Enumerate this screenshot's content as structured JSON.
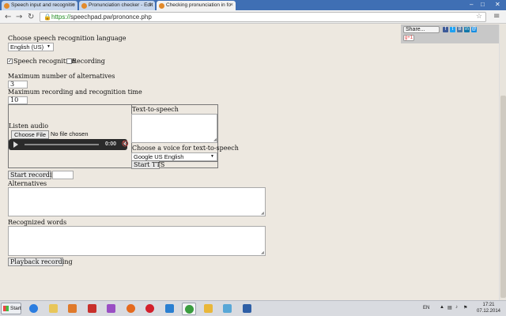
{
  "browser": {
    "tabs": [
      {
        "title": "Speech input and recognitio",
        "active": false
      },
      {
        "title": "Pronunciation checker - Edit",
        "active": false
      },
      {
        "title": "Checking pronunciation in fo",
        "active": true
      }
    ],
    "url_https": "https://",
    "url_rest": "speechpad.pw/prononce.php",
    "window_controls": [
      "–",
      "□",
      "✕"
    ]
  },
  "share": {
    "label": "Share...",
    "icons": [
      {
        "name": "facebook",
        "glyph": "f",
        "color": "#3b5998"
      },
      {
        "name": "twitter",
        "glyph": "t",
        "color": "#1da1f2"
      },
      {
        "name": "vk",
        "glyph": "B",
        "color": "#4c75a3"
      },
      {
        "name": "linkedin",
        "glyph": "in",
        "color": "#0e76a8"
      },
      {
        "name": "mail",
        "glyph": "@",
        "color": "#168de2"
      }
    ],
    "gplus_label": "g+1"
  },
  "form": {
    "lang_label": "Choose speech recognition language",
    "lang_value": "English (US)",
    "speech_recognition_label": "Speech recognition",
    "speech_recognition_checked": true,
    "recording_label": "Recording",
    "recording_checked": false,
    "max_alt_label": "Maximum number of alternatives",
    "max_alt_value": "3",
    "max_time_label": "Maximum recording and recognition time",
    "max_time_value": "10",
    "listen_label": "Listen audio",
    "choose_file_label": "Choose File",
    "no_file_label": "No file chosen",
    "audio_time": "0:00",
    "tts_label": "Text-to-speech",
    "voice_label": "Choose a voice for text-to-speech",
    "voice_value": "Google US English",
    "start_tts_label": "Start TTS",
    "start_recording_label": "Start recording",
    "alternatives_label": "Alternatives",
    "recognized_label": "Recognized words",
    "playback_label": "Playback recording"
  },
  "taskbar": {
    "start_label": "Start",
    "apps": [
      {
        "name": "ie",
        "color": "#2b7de0"
      },
      {
        "name": "explorer",
        "color": "#e8c65a"
      },
      {
        "name": "media-player",
        "color": "#e07a2b"
      },
      {
        "name": "flash",
        "color": "#c8302b"
      },
      {
        "name": "paint",
        "color": "#9a4fc4"
      },
      {
        "name": "firefox",
        "color": "#e56a1e"
      },
      {
        "name": "opera",
        "color": "#d3202c"
      },
      {
        "name": "xsplit",
        "color": "#2a7fd1"
      },
      {
        "name": "chrome",
        "color": "#3a9d3f"
      },
      {
        "name": "pencil",
        "color": "#e9b73a"
      },
      {
        "name": "onenote",
        "color": "#58a7d7"
      },
      {
        "name": "monitor",
        "color": "#2e5fa6"
      }
    ],
    "active_app": "chrome",
    "language": "EN",
    "time": "17:21",
    "date": "07.12.2014"
  }
}
